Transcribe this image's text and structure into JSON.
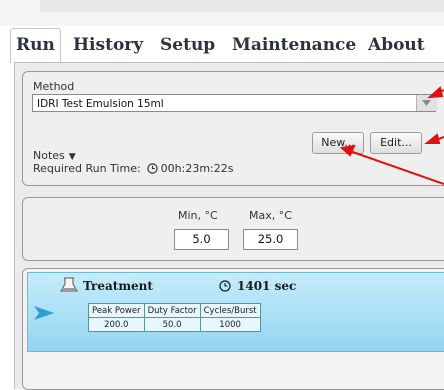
{
  "tabs": [
    {
      "label": "Run",
      "active": true
    },
    {
      "label": "History",
      "active": false
    },
    {
      "label": "Setup",
      "active": false
    },
    {
      "label": "Maintenance",
      "active": false
    },
    {
      "label": "About",
      "active": false
    }
  ],
  "method": {
    "label": "Method",
    "selected": "IDRI Test Emulsion 15ml",
    "new_label": "New...",
    "edit_label": "Edit...",
    "notes_label": "Notes",
    "runtime_label": "Required Run Time:",
    "runtime_value": "00h:23m:22s"
  },
  "temperature": {
    "min_label": "Min, °C",
    "max_label": "Max, °C",
    "min_value": "5.0",
    "max_value": "25.0"
  },
  "treatment": {
    "title": "Treatment",
    "time": "1401 sec",
    "headers": [
      "Peak Power",
      "Duty Factor",
      "Cycles/Burst"
    ],
    "values": [
      "200.0",
      "50.0",
      "1000"
    ]
  },
  "colors": {
    "annotation_arrow": "#e01010",
    "treatment_bg": "#a8ddf3",
    "play_marker": "#2e9fd6"
  }
}
